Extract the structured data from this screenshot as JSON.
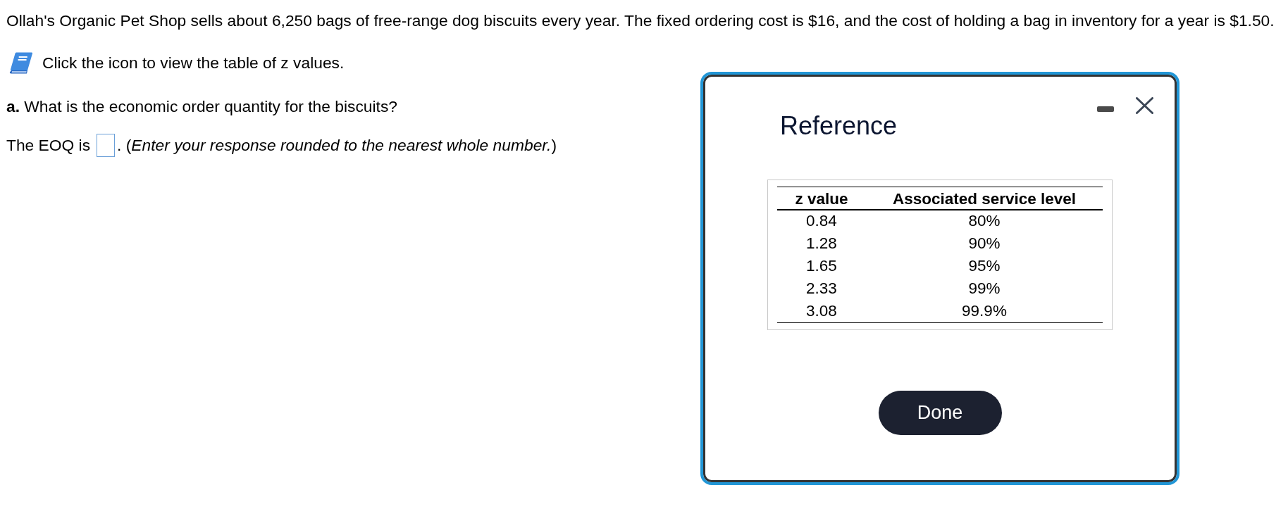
{
  "problem": {
    "statement": "Ollah's Organic Pet Shop sells about 6,250 bags of free-range dog biscuits every year. The fixed ordering cost is $16, and the cost of holding a bag in inventory for a year is $1.50.",
    "reference_hint": "Click the icon to view the table of z values.",
    "question": "**a.** What is the economic order quantity for the biscuits?",
    "answer_prefix": "The EOQ is",
    "answer_suffix": ". (*Enter your response rounded to the nearest whole number.*)"
  },
  "dialog": {
    "title": "Reference",
    "table": {
      "columns": [
        "z value",
        "Associated service level"
      ],
      "rows": [
        [
          "0.84",
          "80%"
        ],
        [
          "1.28",
          "90%"
        ],
        [
          "1.65",
          "95%"
        ],
        [
          "2.33",
          "99%"
        ],
        [
          "3.08",
          "99.9%"
        ]
      ]
    },
    "buttons": [
      "Done"
    ]
  }
}
